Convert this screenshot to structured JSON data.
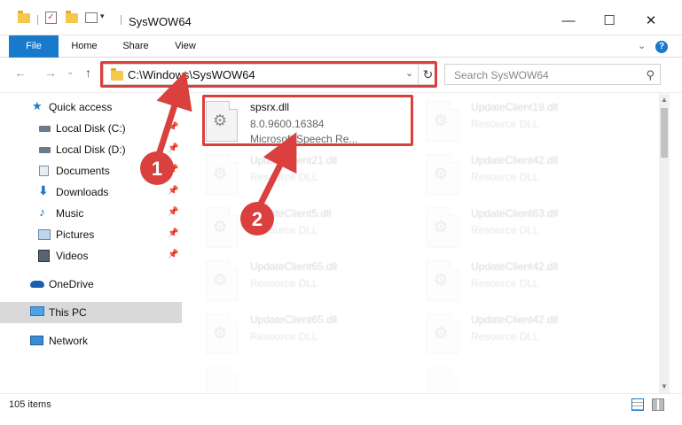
{
  "window": {
    "title": "SysWOW64",
    "minimize_glyph": "—",
    "maximize_glyph": "☐",
    "close_glyph": "✕"
  },
  "ribbon": {
    "tabs": [
      {
        "label": "File"
      },
      {
        "label": "Home"
      },
      {
        "label": "Share"
      },
      {
        "label": "View"
      }
    ],
    "expand_glyph": "⌄",
    "help_glyph": "?"
  },
  "nav": {
    "back_glyph": "←",
    "forward_glyph": "→",
    "recent_glyph": "⌄",
    "up_glyph": "↑"
  },
  "address": {
    "path": "C:\\Windows\\SysWOW64",
    "dropdown_glyph": "⌄",
    "refresh_glyph": "↻"
  },
  "search": {
    "placeholder": "Search SysWOW64",
    "icon_glyph": "⚲"
  },
  "sidebar": {
    "items": [
      {
        "label": "Quick access",
        "icon": "star-icon",
        "pinned": false
      },
      {
        "label": "Local Disk (C:)",
        "icon": "drive-icon",
        "pinned": true
      },
      {
        "label": "Local Disk (D:)",
        "icon": "drive-icon",
        "pinned": true
      },
      {
        "label": "Documents",
        "icon": "documents-icon",
        "pinned": true
      },
      {
        "label": "Downloads",
        "icon": "download-icon",
        "pinned": true
      },
      {
        "label": "Music",
        "icon": "music-icon",
        "pinned": true
      },
      {
        "label": "Pictures",
        "icon": "pictures-icon",
        "pinned": true
      },
      {
        "label": "Videos",
        "icon": "videos-icon",
        "pinned": true
      },
      {
        "label": "OneDrive",
        "icon": "cloud-icon",
        "pinned": false
      },
      {
        "label": "This PC",
        "icon": "computer-icon",
        "pinned": false,
        "selected": true
      },
      {
        "label": "Network",
        "icon": "network-icon",
        "pinned": false
      }
    ],
    "pin_glyph": "📌"
  },
  "files": [
    {
      "name": "spsrx.dll",
      "line1": "8.0.9600.16384",
      "line2": "Microsoft Speech Re...",
      "highlighted": true
    },
    {
      "name": "UpdateClient19.dll",
      "line1": "Resource DLL",
      "line2": ""
    },
    {
      "name": "UpdateClient21.dll",
      "line1": "Resource DLL",
      "line2": ""
    },
    {
      "name": "UpdateClient42.dll",
      "line1": "Resource DLL",
      "line2": ""
    },
    {
      "name": "UpdateClient5.dll",
      "line1": "Resource DLL",
      "line2": ""
    },
    {
      "name": "UpdateClient63.dll",
      "line1": "Resource DLL",
      "line2": ""
    },
    {
      "name": "UpdateClient65.dll",
      "line1": "Resource DLL",
      "line2": ""
    },
    {
      "name": "UpdateClient42.dll",
      "line1": "Resource DLL",
      "line2": ""
    },
    {
      "name": "UpdateClient65.dll",
      "line1": "Resource DLL",
      "line2": ""
    },
    {
      "name": "UpdateClient42.dll",
      "line1": "Resource DLL",
      "line2": ""
    }
  ],
  "file_icon_glyph": "⚙",
  "status": {
    "items_count": "105 items"
  },
  "scrollbar": {
    "up_glyph": "▲",
    "down_glyph": "▼"
  },
  "annotations": {
    "step1": "1",
    "step2": "2"
  },
  "colors": {
    "accent": "#1979ca",
    "highlight": "#d9403e",
    "selection": "#d9d9d9"
  }
}
